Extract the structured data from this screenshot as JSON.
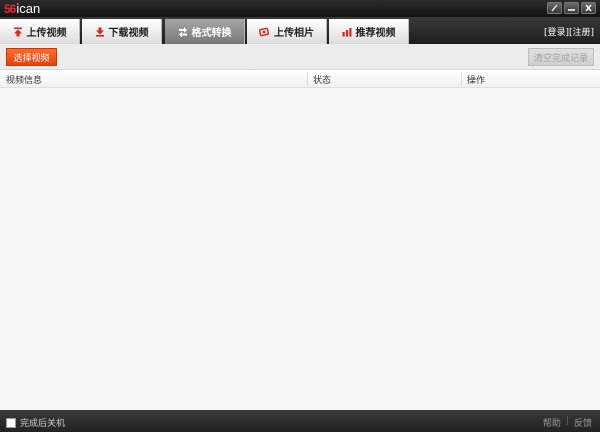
{
  "app": {
    "logo_mark": "56",
    "logo_text": "ican"
  },
  "window_controls": {
    "icons": [
      "pin-icon",
      "minimize-icon",
      "close-icon"
    ]
  },
  "tabs": [
    {
      "label": "上传视频",
      "icon": "upload-arrow-icon",
      "active": false
    },
    {
      "label": "下载视频",
      "icon": "download-arrow-icon",
      "active": false
    },
    {
      "label": "格式转换",
      "icon": "convert-arrows-icon",
      "active": true
    },
    {
      "label": "上传相片",
      "icon": "photo-icon",
      "active": false
    },
    {
      "label": "推荐视频",
      "icon": "recommend-chart-icon",
      "active": false
    }
  ],
  "account": {
    "login": "[登录]",
    "register": "[注册]"
  },
  "toolbar": {
    "select_video": "选择视频",
    "clear_records": "清空完成记录"
  },
  "table": {
    "columns": [
      "视频信息",
      "状态",
      "操作"
    ],
    "rows": []
  },
  "statusbar": {
    "shutdown_label": "完成后关机",
    "shutdown_checked": false,
    "help": "帮助",
    "separator": "|",
    "feedback": "反馈"
  },
  "colors": {
    "accent_orange": "#f05a1e",
    "icon_red": "#d9261c",
    "titlebar": "#1e1e1e"
  }
}
